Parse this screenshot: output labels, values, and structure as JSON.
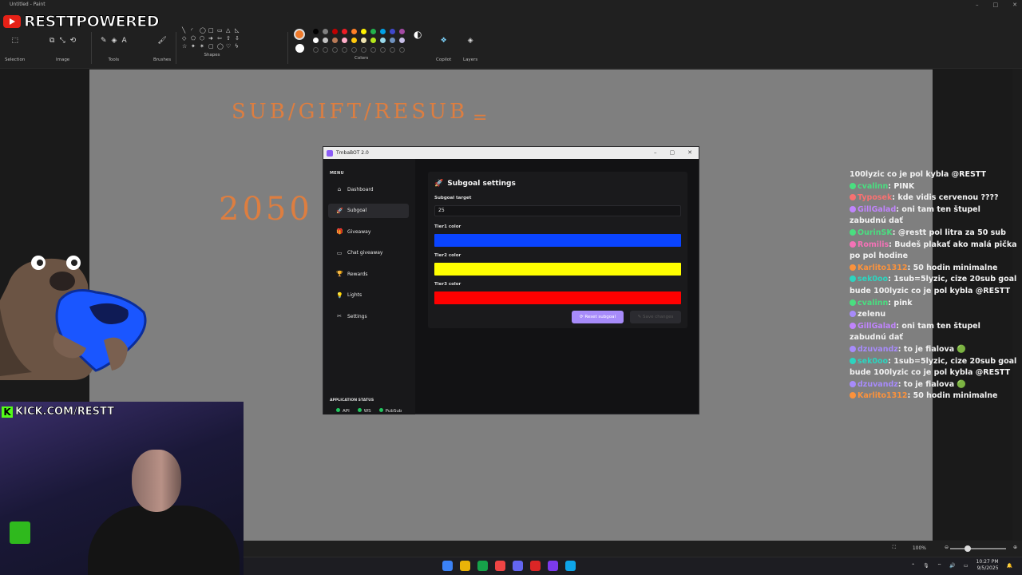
{
  "paint": {
    "window_title": "Untitled - Paint",
    "ribbon_groups": [
      "Selection",
      "Image",
      "Tools",
      "Brushes",
      "Shapes",
      "Colors",
      "Copilot",
      "Layers"
    ],
    "palette": [
      "#000000",
      "#7f7f7f",
      "#c00000",
      "#ed1c24",
      "#ff7f27",
      "#fff200",
      "#22b14c",
      "#00a2e8",
      "#3f48cc",
      "#a349a4",
      "#ffffff",
      "#c3c3c3",
      "#b97a57",
      "#ffaec9",
      "#ffc90e",
      "#efe4b0",
      "#b5e61d",
      "#99d9ea",
      "#7092be",
      "#c8bfe7"
    ],
    "current_color": "#f07a2a",
    "zoom": "100%",
    "canvas_scribbles": [
      "SUB/GIFT/RESUB",
      "=",
      "2050"
    ]
  },
  "overlay": {
    "youtube_text": "RESTTPOWERED",
    "kick_text": "KICK.COM/RESTT",
    "kick_color": "#53fc18"
  },
  "bot": {
    "title": "TmbaBOT 2.0",
    "menu_heading": "MENU",
    "nav": [
      {
        "label": "Dashboard",
        "icon": "home-icon"
      },
      {
        "label": "Subgoal",
        "icon": "rocket-icon"
      },
      {
        "label": "Giveaway",
        "icon": "gift-icon"
      },
      {
        "label": "Chat giveaway",
        "icon": "chat-icon"
      },
      {
        "label": "Rewards",
        "icon": "trophy-icon"
      },
      {
        "label": "Lights",
        "icon": "bulb-icon"
      },
      {
        "label": "Settings",
        "icon": "wrench-icon"
      }
    ],
    "active_nav": "Subgoal",
    "status_heading": "APPLICATION STATUS",
    "statuses": [
      "API",
      "WS",
      "PubSub"
    ],
    "panel": {
      "title": "Subgoal settings",
      "target_label": "Subgoal target",
      "target_value": "25",
      "tier1_label": "Tier1 color",
      "tier1_color": "#0a44ff",
      "tier2_label": "Tier2 color",
      "tier2_color": "#ffff00",
      "tier3_label": "Tier3 color",
      "tier3_color": "#ff0000",
      "reset_label": "Reset subgoal",
      "save_label": "Save changes"
    }
  },
  "chat": [
    {
      "user": "",
      "user_color": "#ffffff",
      "text": "100lyzic co je pol kybla @RESTT"
    },
    {
      "user": "cvalinn",
      "user_color": "#4ade80",
      "text": "PINK"
    },
    {
      "user": "Typosek",
      "user_color": "#f87171",
      "text": "kde vidis cervenou ????"
    },
    {
      "user": "GillGalad",
      "user_color": "#c084fc",
      "text": "oni tam ten štupel zabudnú dať"
    },
    {
      "user": "OurinSK",
      "user_color": "#4ade80",
      "text": "@restt pol litra za 50 sub"
    },
    {
      "user": "Romilis",
      "user_color": "#f472b6",
      "text": "Budeš plakať ako malá pička po pol hodine"
    },
    {
      "user": "Karlito1312",
      "user_color": "#fb923c",
      "text": "50 hodin minimalne"
    },
    {
      "user": "sek0oo",
      "user_color": "#2dd4bf",
      "text": "1sub=5lyzic, cize 20sub goal bude 100lyzic co je pol kybla @RESTT"
    },
    {
      "user": "cvalinn",
      "user_color": "#4ade80",
      "text": "pink"
    },
    {
      "user": "",
      "user_color": "#a78bfa",
      "text": "zelenu"
    },
    {
      "user": "GillGalad",
      "user_color": "#c084fc",
      "text": "oni tam ten štupel zabudnú dať"
    },
    {
      "user": "dzuvandz",
      "user_color": "#a78bfa",
      "text": "to je fialova 🟢"
    },
    {
      "user": "sek0oo",
      "user_color": "#2dd4bf",
      "text": "1sub=5lyzic, cize 20sub goal bude 100lyzic co je pol kybla @RESTT"
    },
    {
      "user": "dzuvandz",
      "user_color": "#a78bfa",
      "text": "to je fialova 🟢"
    },
    {
      "user": "Karlito1312",
      "user_color": "#fb923c",
      "text": "50 hodin minimalne"
    }
  ],
  "taskbar": {
    "time": "10:27 PM",
    "date": "9/5/2025"
  }
}
